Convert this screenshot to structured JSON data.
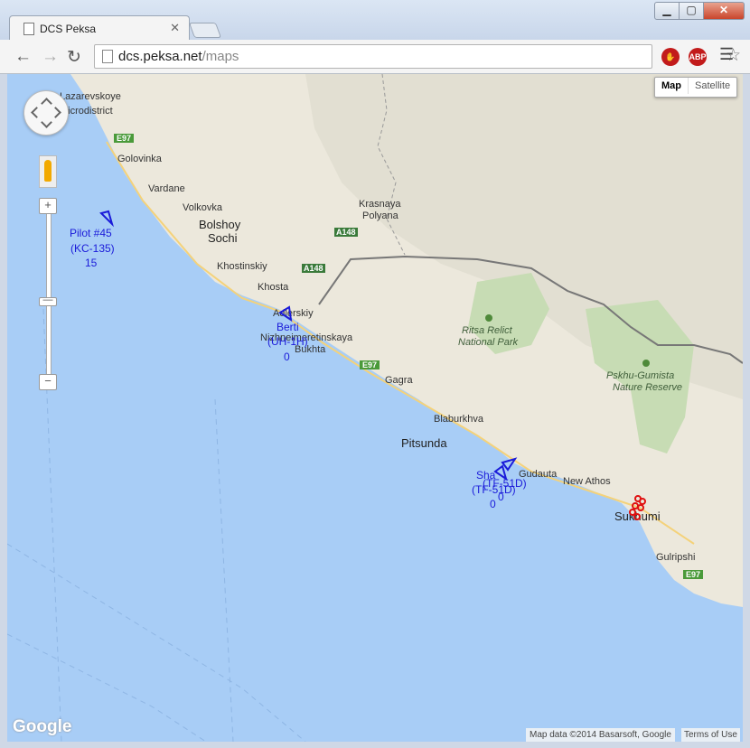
{
  "browser": {
    "tab_title": "DCS Peksa",
    "url_host": "dcs.peksa.net",
    "url_path": "/maps",
    "ext_stop_label": "",
    "ext_abp_label": "ABP"
  },
  "map": {
    "type_buttons": {
      "map": "Map",
      "satellite": "Satellite"
    },
    "places": {
      "lazarevskoye": "Lazarevskoye",
      "microdistrict": "Microdistrict",
      "golovinka": "Golovinka",
      "vardane": "Vardane",
      "volkovka": "Volkovka",
      "bolshoy": "Bolshoy",
      "sochi": "Sochi",
      "khostinskiy": "Khostinskiy",
      "khosta": "Khosta",
      "adlerskiy": "Adlerskiy",
      "nizhneimeretinskaya": "Nizhneimeretinskaya",
      "bukhta": "Bukhta",
      "krasnaya": "Krasnaya",
      "polyana": "Polyana",
      "gagra": "Gagra",
      "blaburkhva": "Blaburkhva",
      "pitsunda": "Pitsunda",
      "new_athos": "New Athos",
      "sukhumi": "Sukhumi",
      "gulripshi": "Gulripshi",
      "ritsa1": "Ritsa Relict",
      "ritsa2": "National Park",
      "pskhu1": "Pskhu-Gumista",
      "pskhu2": "Nature Reserve",
      "gudauta": "Gudauta"
    },
    "roads": {
      "e97": "E97",
      "a148": "A148"
    },
    "units": [
      {
        "line1": "Pilot #45",
        "line2": "(KC-135)",
        "line3": "15"
      },
      {
        "line1": "Berti",
        "line2": "(UH-1H)",
        "line3": "0"
      },
      {
        "line1": "Sha",
        "line2": "(TF-51D)",
        "line3": "0",
        "extra1": "(TF-51D)",
        "extra2": "0"
      }
    ],
    "google": "Google",
    "attribution": "Map data ©2014 Basarsoft, Google",
    "terms": "Terms of Use",
    "zoom_in": "+",
    "zoom_out": "−",
    "zoom_handle": "—"
  }
}
